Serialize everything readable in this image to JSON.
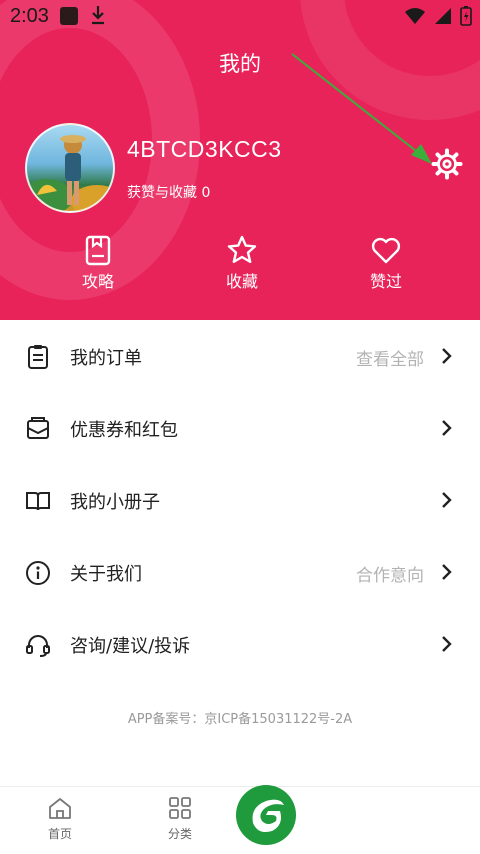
{
  "status_bar": {
    "time": "2:03"
  },
  "header": {
    "title": "我的",
    "username": "4BTCD3KCC3",
    "likes_label": "获赞与收藏 0",
    "quick_actions": [
      {
        "label": "攻略",
        "icon": "guide-book-icon"
      },
      {
        "label": "收藏",
        "icon": "star-icon"
      },
      {
        "label": "赞过",
        "icon": "heart-icon"
      }
    ]
  },
  "menu": [
    {
      "label": "我的订单",
      "hint": "查看全部",
      "icon": "clipboard-icon"
    },
    {
      "label": "优惠券和红包",
      "hint": "",
      "icon": "envelope-icon"
    },
    {
      "label": "我的小册子",
      "hint": "",
      "icon": "open-book-icon"
    },
    {
      "label": "关于我们",
      "hint": "合作意向",
      "icon": "info-icon"
    },
    {
      "label": "咨询/建议/投诉",
      "hint": "",
      "icon": "headset-icon"
    }
  ],
  "footer": {
    "icp": "APP备案号：京ICP备15031122号-2A"
  },
  "tabbar": [
    {
      "label": "首页",
      "icon": "home-icon"
    },
    {
      "label": "分类",
      "icon": "grid-icon"
    }
  ],
  "colors": {
    "brand": "#e8235a",
    "accent_green": "#1f9a3c"
  }
}
